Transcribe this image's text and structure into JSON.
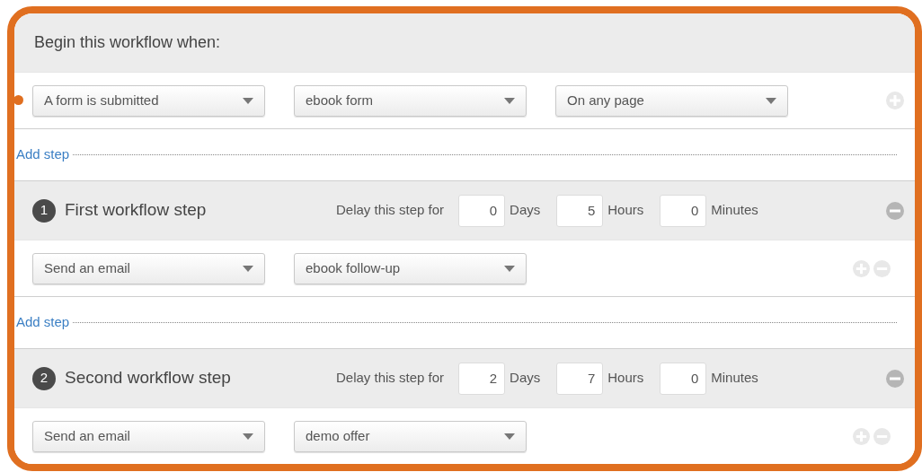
{
  "trigger": {
    "heading": "Begin this workflow when:",
    "dropdowns": [
      "A form is submitted",
      "ebook form",
      "On any page"
    ]
  },
  "steps": [
    {
      "add_step": "Add step",
      "number": "1",
      "title": "First workflow step",
      "delay_label": "Delay this step for",
      "delay": [
        {
          "value": "0",
          "unit": "Days"
        },
        {
          "value": "5",
          "unit": "Hours"
        },
        {
          "value": "0",
          "unit": "Minutes"
        }
      ],
      "dropdowns": [
        "Send an email",
        "ebook follow-up"
      ]
    },
    {
      "add_step": "Add step",
      "number": "2",
      "title": "Second workflow step",
      "delay_label": "Delay this step for",
      "delay": [
        {
          "value": "2",
          "unit": "Days"
        },
        {
          "value": "7",
          "unit": "Hours"
        },
        {
          "value": "0",
          "unit": "Minutes"
        }
      ],
      "dropdowns": [
        "Send an email",
        "demo offer"
      ]
    }
  ]
}
